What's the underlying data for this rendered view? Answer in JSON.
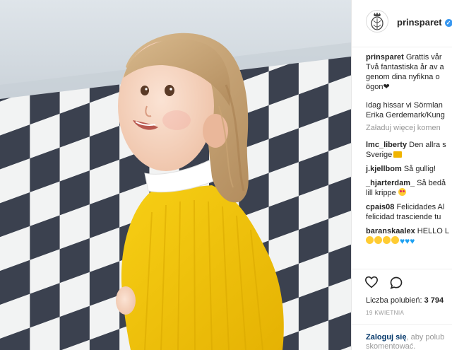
{
  "post": {
    "username": "prinsparet",
    "verified_icon": "verified-badge-icon",
    "caption_user": "prinsparet",
    "caption_lines": [
      "Grattis vår",
      "Två fantastiska år av a",
      "genom dina nyfikna o",
      "ögon"
    ],
    "caption_emoji": "black-heart",
    "caption_line_2": [
      "Idag hissar vi Sörmlan",
      "Erika Gerdemark/Kung"
    ]
  },
  "load_more_label": "Załaduj więcej komen",
  "comments": [
    {
      "user": "lmc_liberty",
      "lines": [
        "Den allra s",
        "Sverige"
      ],
      "emoji": "crown"
    },
    {
      "user": "j.kjellbom",
      "lines": [
        "Så gullig!"
      ]
    },
    {
      "user": "_hjarterdam_",
      "lines": [
        "Så bedå",
        "lill krippe"
      ],
      "emoji": "heart-eyes"
    },
    {
      "user": "cpais08",
      "lines": [
        "Felicidades Al",
        "felicidad trasciende tu"
      ]
    },
    {
      "user": "baranskaalex",
      "lines": [
        "HELLO L"
      ],
      "emoji_row": "smiles-and-blue-hearts"
    }
  ],
  "likes": {
    "label": "Liczba polubień:",
    "count": "3 794"
  },
  "date": "19 KWIETNIA",
  "footer": {
    "login": "Zaloguj się",
    "rest": ", aby polub",
    "line2": "skomentować."
  },
  "colors": {
    "accent": "#3897f0",
    "link": "#003569",
    "muted": "#999999",
    "sweater": "#f2c20a"
  }
}
